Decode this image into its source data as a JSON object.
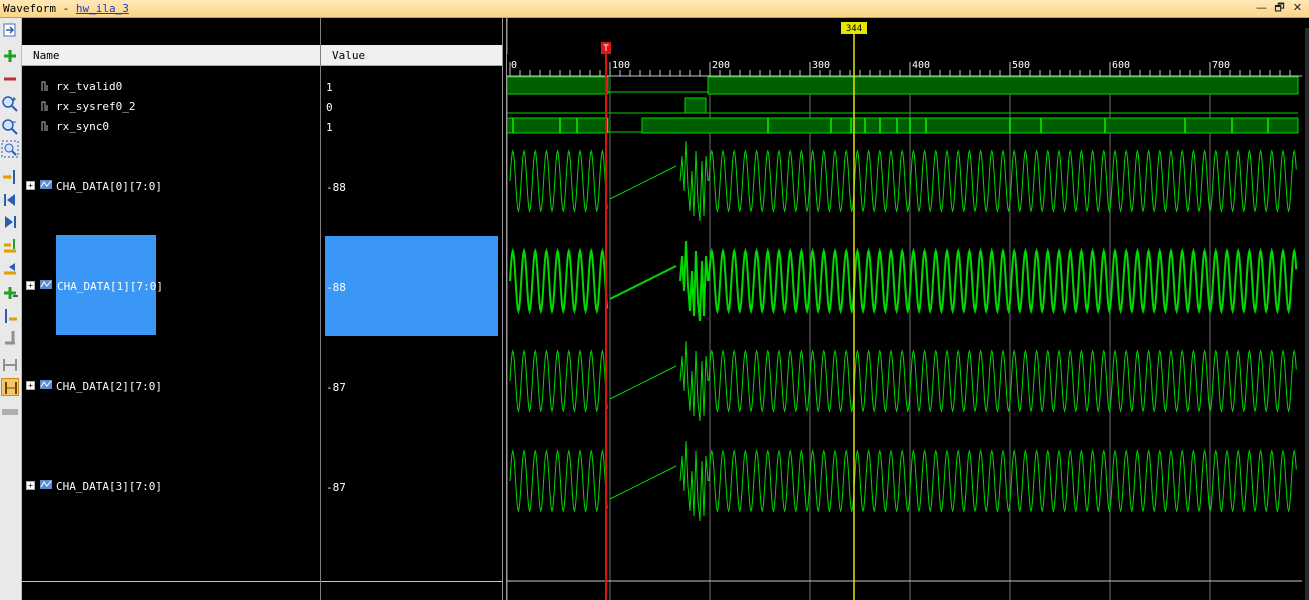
{
  "window": {
    "title_prefix": "Waveform - ",
    "title_link": "hw_ila_3",
    "minimize": "—",
    "restore": "🗗",
    "close": "✕"
  },
  "headers": {
    "name": "Name",
    "value": "Value"
  },
  "signals": [
    {
      "name": "rx_tvalid0",
      "value": "1",
      "kind": "bit"
    },
    {
      "name": "rx_sysref0_2",
      "value": "0",
      "kind": "bit"
    },
    {
      "name": "rx_sync0",
      "value": "1",
      "kind": "bit"
    },
    {
      "name": "CHA_DATA[0][7:0]",
      "value": "-88",
      "kind": "bus"
    },
    {
      "name": "CHA_DATA[1][7:0]",
      "value": "-88",
      "kind": "bus",
      "selected": true
    },
    {
      "name": "CHA_DATA[2][7:0]",
      "value": "-87",
      "kind": "bus"
    },
    {
      "name": "CHA_DATA[3][7:0]",
      "value": "-87",
      "kind": "bus"
    }
  ],
  "timeline": {
    "start_label": "0",
    "major_labels": [
      "100",
      "200",
      "300",
      "400",
      "500",
      "600",
      "700"
    ],
    "trigger_marker": "T",
    "cursor_label": "344",
    "cursor_sample": 344,
    "trigger_sample": 96
  },
  "toolbar_icons": [
    "fit-to-window-icon",
    "add-icon",
    "remove-icon",
    "zoom-in-icon",
    "zoom-out-icon",
    "zoom-fit-icon",
    "go-to-cursor-icon",
    "previous-transition-icon",
    "next-transition-icon",
    "add-marker-icon",
    "previous-marker-icon",
    "next-marker-icon",
    "swap-cursors-icon",
    "snap-icon",
    "float-icon",
    "cursor-mode-icon",
    "divider-icon"
  ],
  "colors": {
    "wave": "#00d800",
    "wave_fill": "#005e00",
    "cursor": "#e6e600",
    "trigger": "#e01010",
    "selection": "#3a97f5",
    "title_bg": "#fcd487"
  }
}
